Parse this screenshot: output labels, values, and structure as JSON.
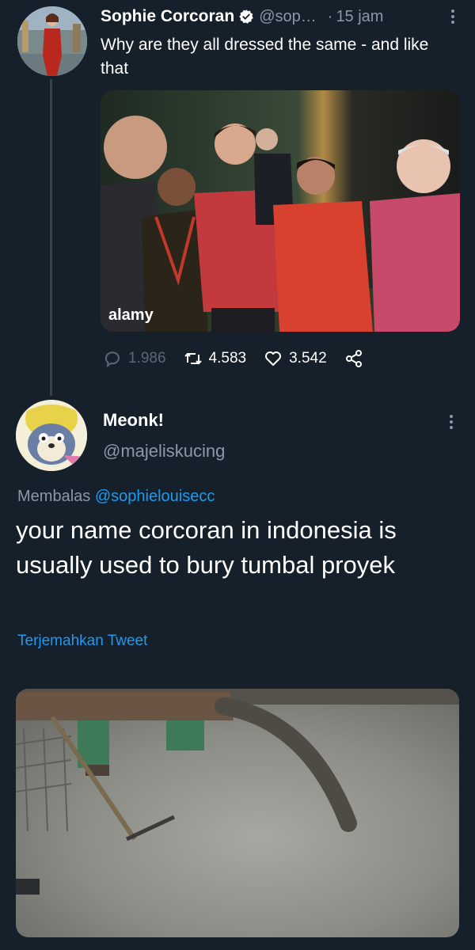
{
  "tweet": {
    "author_name": "Sophie Corcoran",
    "handle": "@sop…",
    "separator": "·",
    "time": "15 jam",
    "text": "Why are they all dressed the same - and like that",
    "media": {
      "watermark": "alamy",
      "description_icon": "photo"
    },
    "stats": {
      "replies": "1.986",
      "retweets": "4.583",
      "likes": "3.542"
    }
  },
  "reply": {
    "author_name": "Meonk!",
    "handle": "@majeliskucing",
    "replying_prefix": "Membalas",
    "replying_to": "@sophielouisecc",
    "text": "your name corcoran in indonesia is usually used to bury tumbal proyek",
    "translate_label": "Terjemahkan Tweet"
  },
  "colors": {
    "background": "#15202b",
    "accent": "#1d9bf0",
    "secondary_text": "#8b98a5",
    "thread_line": "#38444d"
  }
}
